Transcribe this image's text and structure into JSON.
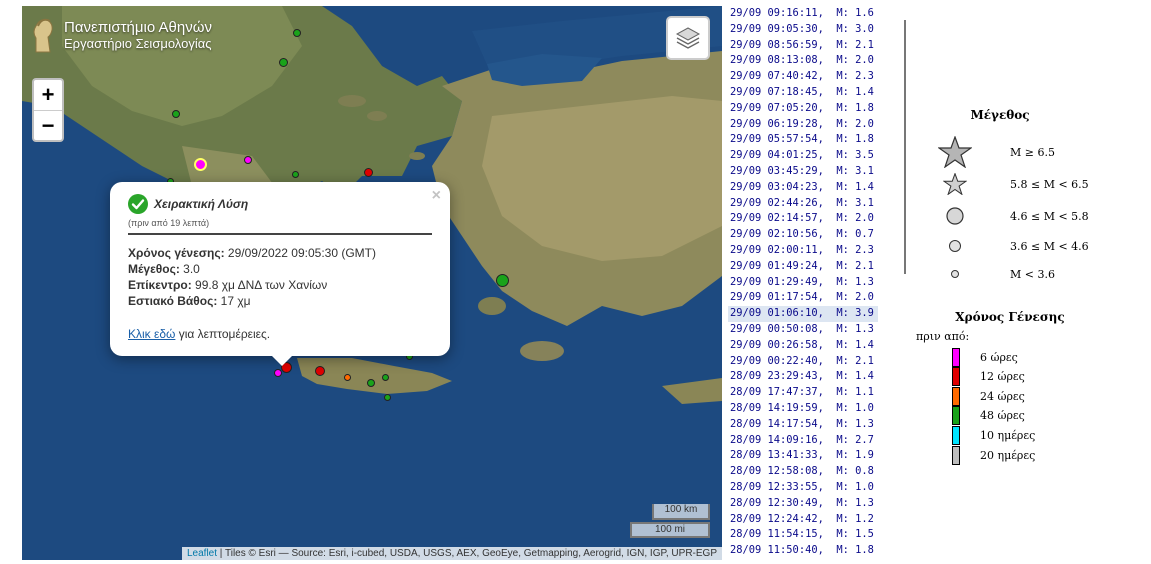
{
  "brand": {
    "line1": "Πανεπιστήμιο Αθηνών",
    "line2": "Εργαστήριο Σεισμολογίας"
  },
  "zoom": {
    "in": "+",
    "out": "−"
  },
  "scale": {
    "km": "100 km",
    "mi": "100 mi"
  },
  "attribution": {
    "leaflet": "Leaflet",
    "rest": " | Tiles © Esri — Source: Esri, i-cubed, USDA, USGS, AEX, GeoEye, Getmapping, Aerogrid, IGN, IGP, UPR-EGP"
  },
  "popup": {
    "close": "×",
    "title": "Χειρακτική Λύση",
    "ago": "(πριν από 19 λεπτά)",
    "origin_label": "Χρόνος γένεσης:",
    "origin_value": " 29/09/2022 09:05:30 (GMT)",
    "mag_label": "Μέγεθος:",
    "mag_value": " 3.0",
    "epi_label": "Επίκεντρο:",
    "epi_value": " 99.8 χμ ΔΝΔ των Χανίων",
    "depth_label": "Εστιακό Βάθος:",
    "depth_value": " 17 χμ",
    "link_text": "Κλικ εδώ",
    "link_rest": " για λεπτομέρειες."
  },
  "events": [
    "29/09 09:16:11,  M: 1.6",
    "29/09 09:05:30,  M: 3.0",
    "29/09 08:56:59,  M: 2.1",
    "29/09 08:13:08,  M: 2.0",
    "29/09 07:40:42,  M: 2.3",
    "29/09 07:18:45,  M: 1.4",
    "29/09 07:05:20,  M: 1.8",
    "29/09 06:19:28,  M: 2.0",
    "29/09 05:57:54,  M: 1.8",
    "29/09 04:01:25,  M: 3.5",
    "29/09 03:45:29,  M: 3.1",
    "29/09 03:04:23,  M: 1.4",
    "29/09 02:44:26,  M: 3.1",
    "29/09 02:14:57,  M: 2.0",
    "29/09 02:10:56,  M: 0.7",
    "29/09 02:00:11,  M: 2.3",
    "29/09 01:49:24,  M: 2.1",
    "29/09 01:29:49,  M: 1.3",
    "29/09 01:17:54,  M: 2.0",
    "29/09 01:06:10,  M: 3.9",
    "29/09 00:50:08,  M: 1.3",
    "29/09 00:26:58,  M: 1.4",
    "29/09 00:22:40,  M: 2.1",
    "28/09 23:29:43,  M: 1.4",
    "28/09 17:47:37,  M: 1.1",
    "28/09 14:19:59,  M: 1.0",
    "28/09 14:17:54,  M: 1.3",
    "28/09 14:09:16,  M: 2.7",
    "28/09 13:41:33,  M: 1.9",
    "28/09 12:58:08,  M: 0.8",
    "28/09 12:33:55,  M: 1.0",
    "28/09 12:30:49,  M: 1.3",
    "28/09 12:24:42,  M: 1.2",
    "28/09 11:54:15,  M: 1.5",
    "28/09 11:50:40,  M: 1.8"
  ],
  "selected_event_index": 19,
  "legend": {
    "magnitude_title": "Μέγεθος",
    "magnitudes": [
      "M ≥ 6.5",
      "5.8 ≤  M < 6.5",
      "4.6 ≤  M < 5.8",
      "3.6 ≤  M < 4.6",
      "M < 3.6"
    ],
    "time_title": "Χρόνος Γένεσης",
    "time_prefix": "πριν από:",
    "times": [
      {
        "label": "6 ώρες",
        "color": "#ff00ff"
      },
      {
        "label": "12 ώρες",
        "color": "#e00000"
      },
      {
        "label": "24 ώρες",
        "color": "#ff6a00"
      },
      {
        "label": "48 ώρες",
        "color": "#1aa31a"
      },
      {
        "label": "10 ημέρες",
        "color": "#00e5ff"
      },
      {
        "label": "20 ημέρες",
        "color": "#bdbdbd"
      }
    ]
  }
}
